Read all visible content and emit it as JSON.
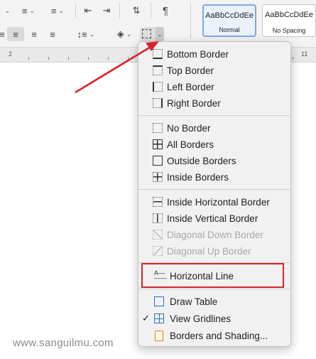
{
  "ribbon": {
    "styles": [
      {
        "preview": "AaBbCcDdEe",
        "name": "Normal"
      },
      {
        "preview": "AaBbCcDdEe",
        "name": "No Spacing"
      }
    ]
  },
  "ruler": {
    "labels": [
      "2",
      "11"
    ]
  },
  "border_menu": {
    "groups": [
      [
        {
          "label": "Bottom Border",
          "icon": "bottom-border-icon",
          "enabled": true
        },
        {
          "label": "Top Border",
          "icon": "top-border-icon",
          "enabled": true
        },
        {
          "label": "Left Border",
          "icon": "left-border-icon",
          "enabled": true
        },
        {
          "label": "Right Border",
          "icon": "right-border-icon",
          "enabled": true
        }
      ],
      [
        {
          "label": "No Border",
          "icon": "no-border-icon",
          "enabled": true
        },
        {
          "label": "All Borders",
          "icon": "all-borders-icon",
          "enabled": true
        },
        {
          "label": "Outside Borders",
          "icon": "outside-borders-icon",
          "enabled": true
        },
        {
          "label": "Inside Borders",
          "icon": "inside-borders-icon",
          "enabled": true
        }
      ],
      [
        {
          "label": "Inside Horizontal Border",
          "icon": "inside-horizontal-border-icon",
          "enabled": true
        },
        {
          "label": "Inside Vertical Border",
          "icon": "inside-vertical-border-icon",
          "enabled": true
        },
        {
          "label": "Diagonal Down Border",
          "icon": "diagonal-down-border-icon",
          "enabled": false
        },
        {
          "label": "Diagonal Up Border",
          "icon": "diagonal-up-border-icon",
          "enabled": false
        }
      ],
      [
        {
          "label": "Horizontal Line",
          "icon": "horizontal-line-icon",
          "enabled": true
        }
      ],
      [
        {
          "label": "Draw Table",
          "icon": "draw-table-icon",
          "enabled": true
        },
        {
          "label": "View Gridlines",
          "icon": "view-gridlines-icon",
          "enabled": true,
          "checked": true
        },
        {
          "label": "Borders and Shading...",
          "icon": "borders-shading-icon",
          "enabled": true
        }
      ]
    ]
  },
  "annotation": {
    "highlight_color": "#d8232a",
    "arrow_color": "#d8232a"
  },
  "watermark": "www.sanguilmu.com"
}
